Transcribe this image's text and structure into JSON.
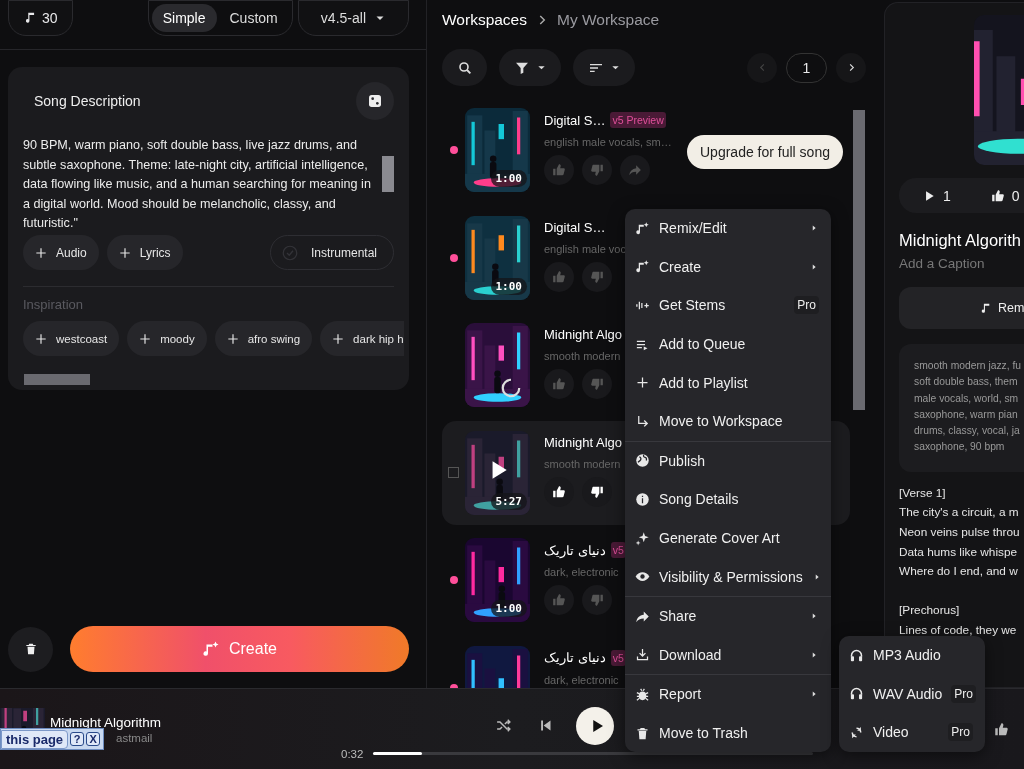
{
  "top_bar": {
    "credits": "30",
    "mode_tabs": [
      {
        "label": "Simple",
        "selected": true
      },
      {
        "label": "Custom",
        "selected": false
      }
    ],
    "model": "v4.5-all"
  },
  "song_description": {
    "title": "Song Description",
    "text": "90 BPM, warm piano, soft double bass, live jazz drums, and subtle saxophone. Theme: late-night city, artificial intelligence, data flowing like music, and a human searching for meaning in a digital world. Mood should be melancholic, classy, and futuristic.\"",
    "add_buttons": [
      "Audio",
      "Lyrics"
    ],
    "instrumental": {
      "label": "Instrumental",
      "checked": false
    }
  },
  "inspiration": {
    "label": "Inspiration",
    "chips": [
      "westcoast",
      "moody",
      "afro swing",
      "dark hip h"
    ]
  },
  "create_button": "Create",
  "breadcrumb": [
    "Workspaces",
    "My Workspace"
  ],
  "pagination": {
    "page": "1"
  },
  "songs": [
    {
      "title": "Digital S…",
      "badge": "v5 Preview",
      "description": "english male vocals, sm…",
      "duration": "1:00",
      "unplayed": true,
      "selected": false,
      "loading": false,
      "actions": [
        {
          "kind": "like"
        },
        {
          "kind": "dislike"
        },
        {
          "kind": "share"
        }
      ]
    },
    {
      "title": "Digital S…",
      "description": "english male voc",
      "duration": "1:00",
      "unplayed": true,
      "selected": false,
      "loading": false,
      "actions": [
        {
          "kind": "like"
        },
        {
          "kind": "dislike"
        }
      ]
    },
    {
      "title": "Midnight Algo",
      "description": "smooth modern",
      "unplayed": false,
      "selected": false,
      "loading": true,
      "actions": [
        {
          "kind": "like"
        },
        {
          "kind": "dislike"
        }
      ]
    },
    {
      "title": "Midnight Algo",
      "description": "smooth modern",
      "duration": "5:27",
      "selected": true,
      "loading": false,
      "actions": [
        {
          "kind": "like"
        },
        {
          "kind": "dislike"
        }
      ]
    },
    {
      "title": "دنیای تاریک",
      "badge": "v5",
      "description": "dark, electronic",
      "duration": "1:00",
      "unplayed": true,
      "selected": false,
      "loading": false,
      "actions": [
        {
          "kind": "like"
        },
        {
          "kind": "dislike"
        }
      ]
    },
    {
      "title": "دنیای تاریک",
      "badge": "v5",
      "description": "dark, electronic",
      "unplayed": true,
      "selected": false,
      "loading": false
    }
  ],
  "tooltip": "Upgrade for full song",
  "context_menu": {
    "groups": [
      [
        {
          "label": "Remix/Edit",
          "submenu": true
        },
        {
          "label": "Create",
          "submenu": true
        },
        {
          "label": "Get Stems",
          "submenu": false,
          "badge": "Pro"
        },
        {
          "label": "Add to Queue",
          "submenu": false
        },
        {
          "label": "Add to Playlist",
          "submenu": false
        },
        {
          "label": "Move to Workspace",
          "submenu": false
        }
      ],
      [
        {
          "label": "Publish",
          "submenu": false
        },
        {
          "label": "Song Details",
          "submenu": false
        },
        {
          "label": "Generate Cover Art",
          "submenu": false
        },
        {
          "label": "Visibility & Permissions",
          "submenu": true
        }
      ],
      [
        {
          "label": "Share",
          "submenu": true
        },
        {
          "label": "Download",
          "submenu": true
        }
      ],
      [
        {
          "label": "Report",
          "submenu": true
        },
        {
          "label": "Move to Trash",
          "submenu": false
        }
      ]
    ]
  },
  "download_submenu": [
    {
      "label": "MP3 Audio"
    },
    {
      "label": "WAV Audio",
      "badge": "Pro"
    },
    {
      "label": "Video",
      "badge": "Pro"
    }
  ],
  "song_panel": {
    "stats": [
      {
        "kind": "plays",
        "value": "1"
      },
      {
        "kind": "likes",
        "value": "0"
      }
    ],
    "title": "Midnight Algorith",
    "caption_placeholder": "Add a Caption",
    "remix_button": "Rem",
    "tags": "smooth modern jazz, fu\nsoft double bass, them\nmale vocals, world, sm\nsaxophone, warm pian\ndrums, classy, vocal, ja\nsaxophone, 90 bpm",
    "lyrics": "[Verse 1]\nThe city's a circuit, a m\nNeon veins pulse throu\nData hums like whispe\nWhere do I end, and w\n\n[Prechorus]\nLines of code, they we"
  },
  "player": {
    "title": "Midnight Algorithm",
    "artist": "astmail",
    "elapsed": "0:32",
    "level": 0.11
  },
  "translate_bar": {
    "label": "this page",
    "buttons": [
      "?",
      "X"
    ]
  }
}
